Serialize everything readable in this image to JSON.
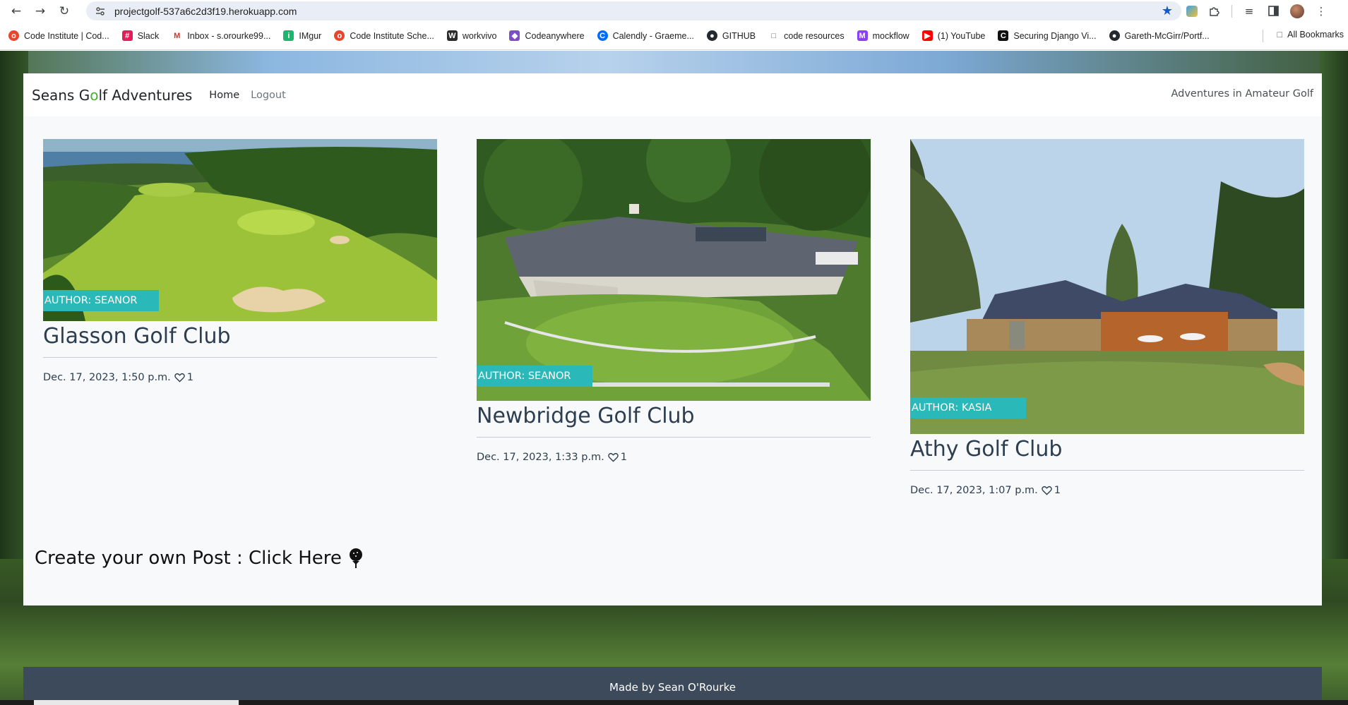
{
  "browser": {
    "url": "projectgolf-537a6c2d3f19.herokuapp.com",
    "back_icon": "arrow-left-icon",
    "forward_icon": "arrow-right-icon",
    "reload_icon": "reload-icon",
    "bookmarks": [
      {
        "label": "Code Institute | Cod...",
        "icon": "code-institute-icon",
        "color": "#e8452c"
      },
      {
        "label": "Slack",
        "icon": "slack-icon",
        "color": "#e01e5a"
      },
      {
        "label": "Inbox - s.orourke99...",
        "icon": "gmail-icon",
        "color": "#d93025"
      },
      {
        "label": "IMgur",
        "icon": "imgur-icon",
        "color": "#1bb76e"
      },
      {
        "label": "Code Institute Sche...",
        "icon": "code-institute-icon",
        "color": "#e8452c"
      },
      {
        "label": "workvivo",
        "icon": "workvivo-icon",
        "color": "#2b2b2b"
      },
      {
        "label": "Codeanywhere",
        "icon": "codeanywhere-icon",
        "color": "#7b4fc9"
      },
      {
        "label": "Calendly - Graeme...",
        "icon": "calendly-icon",
        "color": "#006bff"
      },
      {
        "label": "GITHUB",
        "icon": "github-icon",
        "color": "#24292f"
      },
      {
        "label": "code resources",
        "icon": "folder-icon",
        "color": "#5f6368"
      },
      {
        "label": "mockflow",
        "icon": "mockflow-icon",
        "color": "#8a3ffc"
      },
      {
        "label": "(1) YouTube",
        "icon": "youtube-icon",
        "color": "#ff0000"
      },
      {
        "label": "Securing Django Vi...",
        "icon": "bookmark-c-icon",
        "color": "#111111"
      },
      {
        "label": "Gareth-McGirr/Portf...",
        "icon": "github-icon",
        "color": "#24292f"
      }
    ],
    "all_bookmarks": "All Bookmarks"
  },
  "navbar": {
    "brand_pre": "Seans G",
    "brand_o": "o",
    "brand_post": "lf Adventures",
    "home": "Home",
    "logout": "Logout",
    "tagline": "Adventures in Amateur Golf"
  },
  "posts": [
    {
      "author": "AUTHOR: SEANOR",
      "title": "Glasson Golf Club",
      "date": "Dec. 17, 2023, 1:50 p.m.",
      "likes": "1"
    },
    {
      "author": "AUTHOR: SEANOR",
      "title": "Newbridge Golf Club",
      "date": "Dec. 17, 2023, 1:33 p.m.",
      "likes": "1"
    },
    {
      "author": "AUTHOR: KASIA",
      "title": "Athy Golf Club",
      "date": "Dec. 17, 2023, 1:07 p.m.",
      "likes": "1"
    }
  ],
  "create_post": "Create your own Post : Click Here",
  "footer": "Made by Sean O'Rourke",
  "colors": {
    "badge": "#2ab8b8",
    "brand_o": "#4caf2e",
    "footer_bg": "#3d4a5c",
    "title": "#2c3e50"
  }
}
